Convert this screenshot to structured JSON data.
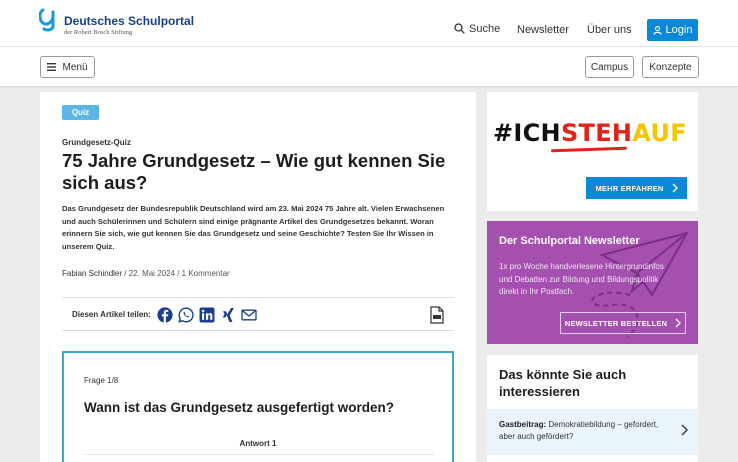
{
  "header": {
    "logo_title": "Deutsches Schulportal",
    "logo_subtitle": "der Robert Bosch Stiftung",
    "nav": {
      "search": "Suche",
      "newsletter": "Newsletter",
      "about": "Über uns",
      "login": "Login"
    }
  },
  "subbar": {
    "menu": "Menü",
    "campus": "Campus",
    "concepts": "Konzepte"
  },
  "article": {
    "badge": "Quiz",
    "kicker": "Grundgesetz-Quiz",
    "headline": "75 Jahre Grundgesetz – Wie gut kennen Sie sich aus?",
    "lead": "Das Grundgesetz der Bundesrepublik Deutschland wird am 23. Mai 2024 75 Jahre alt. Vielen Erwachsenen und auch Schülerinnen und Schülern sind einige prägnante Artikel des Grundgesetzes bekannt. Woran erinnern Sie sich, wie gut kennen Sie das Grundgesetz und seine Geschichte? Testen Sie Ihr Wissen in unserem Quiz.",
    "author": "Fabian Schindler",
    "date": "/ 22. Mai 2024",
    "comments": "/ 1 Kommentar",
    "share_label": "Diesen Artikel teilen:",
    "share_icons": [
      "facebook-icon",
      "whatsapp-icon",
      "linkedin-icon",
      "xing-icon",
      "mail-icon"
    ]
  },
  "quiz": {
    "progress": "Frage 1/8",
    "question": "Wann ist das Grundgesetz ausgefertigt worden?",
    "answer_label": "Antwort 1"
  },
  "sidebar": {
    "ad": {
      "hash": "#ICH",
      "steh": "STEH",
      "auf": "AUF",
      "button": "MEHR ERFAHREN"
    },
    "newsletter": {
      "title": "Der Schulportal Newsletter",
      "body": "1x pro Woche handverlesene Hintergrundinfos und Debatten zur Bildung und Bildungspolitik direkt in Ihr Postfach.",
      "button": "NEWSLETTER BESTELLEN"
    },
    "recommendations": {
      "title": "Das könnte Sie auch interessieren",
      "item_prefix": "Gastbeitrag:",
      "item_text": " Demokratiebildung – gefordert, aber auch gefördert?"
    }
  },
  "colors": {
    "brand_blue": "#0a8ad6",
    "logo_blue": "#1a3d8f",
    "newsletter_purple": "#a54fb0",
    "quiz_border": "#3ea3d9"
  }
}
